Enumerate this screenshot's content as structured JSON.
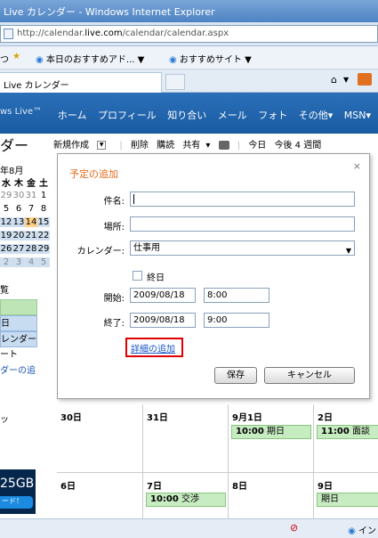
{
  "browser": {
    "window_title": "Live カレンダー - Windows Internet Explorer",
    "url_prefix": "http://calendar.",
    "url_domain": "live.com",
    "url_suffix": "/calendar/calendar.aspx",
    "fav_recommended_addons": "本日のおすすめアド...",
    "fav_recommended_sites": "おすすめサイト",
    "tab_label": "Live カレンダー"
  },
  "header": {
    "brand": "ws Live™",
    "nav": [
      "ホーム",
      "プロフィール",
      "知り合い",
      "メール",
      "フォト",
      "その他▾",
      "MSN▾"
    ]
  },
  "left_pane": {
    "page_title": "ダー",
    "mini_cal_title": "年8月",
    "mini_cal_head": [
      "水",
      "木",
      "金",
      "土"
    ],
    "mini_cal_rows": [
      [
        "29",
        "30",
        "31",
        "1"
      ],
      [
        "5",
        "6",
        "7",
        "8"
      ],
      [
        "12",
        "13",
        "14",
        "15"
      ],
      [
        "19",
        "20",
        "21",
        "22"
      ],
      [
        "26",
        "27",
        "28",
        "29"
      ],
      [
        "2",
        "3",
        "4",
        "5"
      ]
    ],
    "labels": [
      "覧",
      "",
      "日",
      "レンダー",
      "ート",
      "ダーの追"
    ],
    "misc_label": "ッ",
    "store_gb": "25GB",
    "store_button": "ード！"
  },
  "toolbar": {
    "new": "新規作成",
    "delete": "削除",
    "subscribe": "購読",
    "share": "共有",
    "today": "今日",
    "next_4_weeks": "今後 4 週間"
  },
  "dialog": {
    "title": "予定の追加",
    "close": "×",
    "subject_label": "件名:",
    "subject_value": "",
    "location_label": "場所:",
    "location_value": "",
    "calendar_label": "カレンダー:",
    "calendar_value": "仕事用",
    "allday_label": "終日",
    "start_label": "開始:",
    "start_date": "2009/08/18",
    "start_time": "8:00",
    "end_label": "終了:",
    "end_date": "2009/08/18",
    "end_time": "9:00",
    "details_link": "詳細の追加",
    "save": "保存",
    "cancel": "キャンセル"
  },
  "grid": {
    "row1": [
      {
        "date": "30日"
      },
      {
        "date": "31日"
      },
      {
        "date": "9月1日",
        "event_time": "10:00",
        "event_title": "期日"
      },
      {
        "date": "2日",
        "event_time": "11:00",
        "event_title": "面談"
      }
    ],
    "row2": [
      {
        "date": "6日"
      },
      {
        "date": "7日",
        "event_time": "10:00",
        "event_title": "交渉"
      },
      {
        "date": "8日"
      },
      {
        "date": "9日",
        "event_title": "期日"
      }
    ]
  },
  "status": {
    "zone": "イン"
  },
  "colors": {
    "header_blue": "#1a5ca3",
    "dialog_title_orange": "#e66a1a",
    "highlight_red": "#e00000",
    "event_green": "#c8ecc2"
  }
}
